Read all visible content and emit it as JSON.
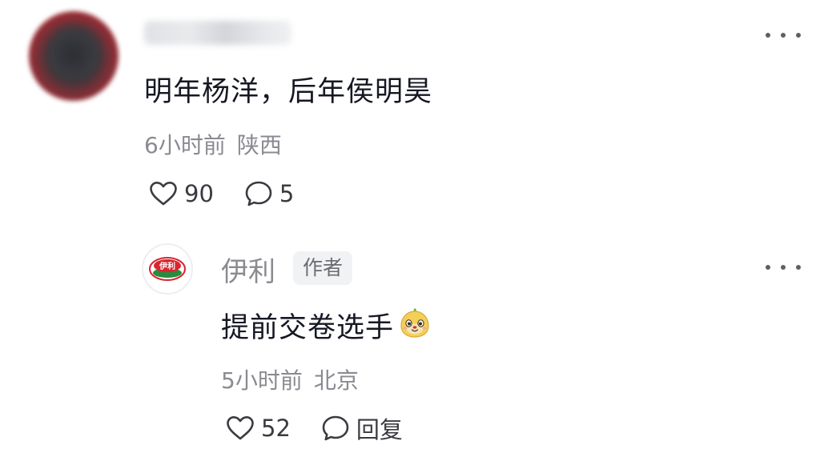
{
  "comment": {
    "avatar": "blurred-avatar",
    "username": "",
    "text": "明年杨洋，后年侯明昊",
    "time": "6小时前",
    "location": "陕西",
    "likes": "90",
    "replies": "5",
    "like_icon": "heart-outline-icon",
    "reply_icon": "comment-bubble-icon",
    "more_icon": "more-dots-icon"
  },
  "reply": {
    "avatar_logo": "伊利",
    "name": "伊利",
    "badge": "作者",
    "text": "提前交卷选手",
    "emoji": "smiling-pear-emoji",
    "time": "5小时前",
    "location": "北京",
    "likes": "52",
    "reply_label": "回复",
    "more_icon": "more-dots-icon"
  },
  "colors": {
    "primary_text": "#161823",
    "secondary_text": "#8a8b91",
    "icon": "#3a3b41",
    "badge_bg": "#f1f2f4",
    "brand_red": "#d9252f",
    "brand_green": "#2a8a3e"
  }
}
